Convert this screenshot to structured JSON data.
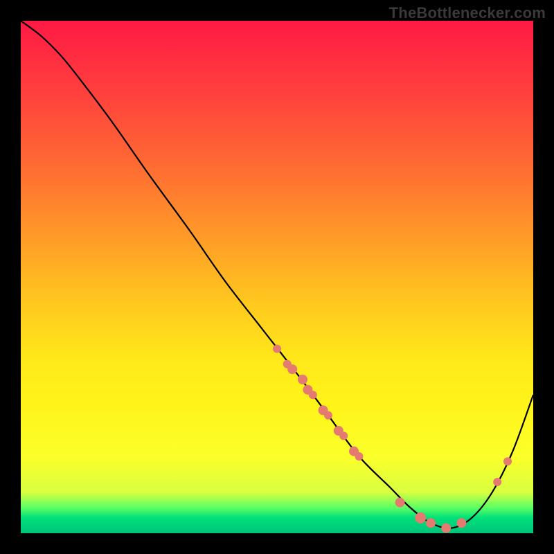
{
  "watermark": "TheBottlenecker.com",
  "chart_data": {
    "type": "line",
    "title": "",
    "xlabel": "",
    "ylabel": "",
    "xlim": [
      0,
      100
    ],
    "ylim": [
      0,
      100
    ],
    "grid": false,
    "series": [
      {
        "name": "curve",
        "color": "#000000",
        "x": [
          0,
          4,
          8,
          12,
          18,
          25,
          33,
          40,
          47,
          54,
          60,
          66,
          72,
          76,
          80,
          84,
          88,
          92,
          96,
          100
        ],
        "y": [
          100,
          97,
          93,
          88,
          80,
          70,
          59,
          49,
          40,
          31,
          23,
          15,
          9,
          5,
          2,
          1,
          3,
          8,
          16,
          27
        ]
      }
    ],
    "markers": [
      {
        "x": 50,
        "y": 36,
        "r": 6
      },
      {
        "x": 52,
        "y": 33,
        "r": 6
      },
      {
        "x": 53,
        "y": 32,
        "r": 7
      },
      {
        "x": 55,
        "y": 30,
        "r": 7
      },
      {
        "x": 56,
        "y": 28,
        "r": 7
      },
      {
        "x": 57,
        "y": 27,
        "r": 6
      },
      {
        "x": 59,
        "y": 24,
        "r": 7
      },
      {
        "x": 60,
        "y": 23,
        "r": 6
      },
      {
        "x": 62,
        "y": 20,
        "r": 7
      },
      {
        "x": 63,
        "y": 19,
        "r": 6
      },
      {
        "x": 65,
        "y": 16,
        "r": 7
      },
      {
        "x": 66,
        "y": 15,
        "r": 6
      },
      {
        "x": 74,
        "y": 6,
        "r": 7
      },
      {
        "x": 78,
        "y": 3,
        "r": 8
      },
      {
        "x": 80,
        "y": 2,
        "r": 7
      },
      {
        "x": 83,
        "y": 1,
        "r": 7
      },
      {
        "x": 86,
        "y": 2,
        "r": 7
      },
      {
        "x": 93,
        "y": 10,
        "r": 6
      },
      {
        "x": 95,
        "y": 14,
        "r": 6
      }
    ],
    "marker_color": "#e47a70"
  }
}
